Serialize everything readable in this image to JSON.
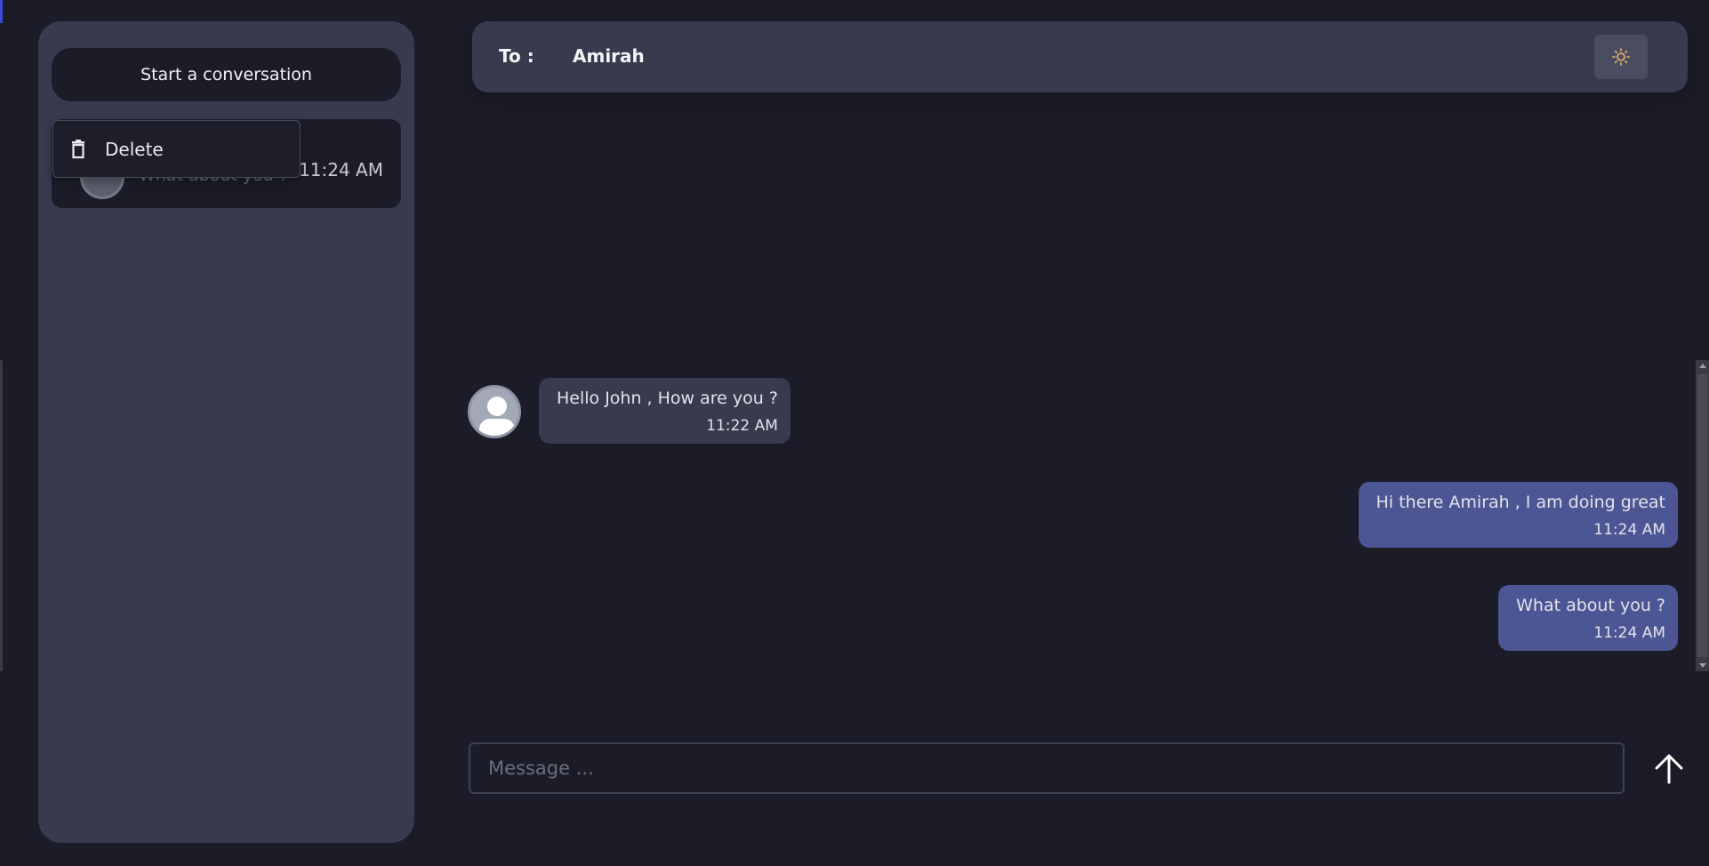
{
  "sidebar": {
    "start_button_label": "Start a conversation",
    "conversation": {
      "preview": "What about you ?",
      "time": "11:24 AM"
    },
    "context_menu": {
      "delete_label": "Delete"
    }
  },
  "header": {
    "to_label": "To :",
    "recipient": "Amirah",
    "theme_icon": "sun-icon"
  },
  "messages": [
    {
      "direction": "incoming",
      "text": "Hello John , How are you ?",
      "time": "11:22 AM"
    },
    {
      "direction": "outgoing",
      "text": "Hi there Amirah , I am doing great",
      "time": "11:24 AM"
    },
    {
      "direction": "outgoing",
      "text": "What about you ?",
      "time": "11:24 AM"
    }
  ],
  "composer": {
    "placeholder": "Message ...",
    "value": "",
    "send_icon": "arrow-up-icon"
  },
  "colors": {
    "background": "#1b1c28",
    "panel": "#383a4e",
    "outgoing_bubble": "#4d5694",
    "accent": "#3b4bd6"
  }
}
